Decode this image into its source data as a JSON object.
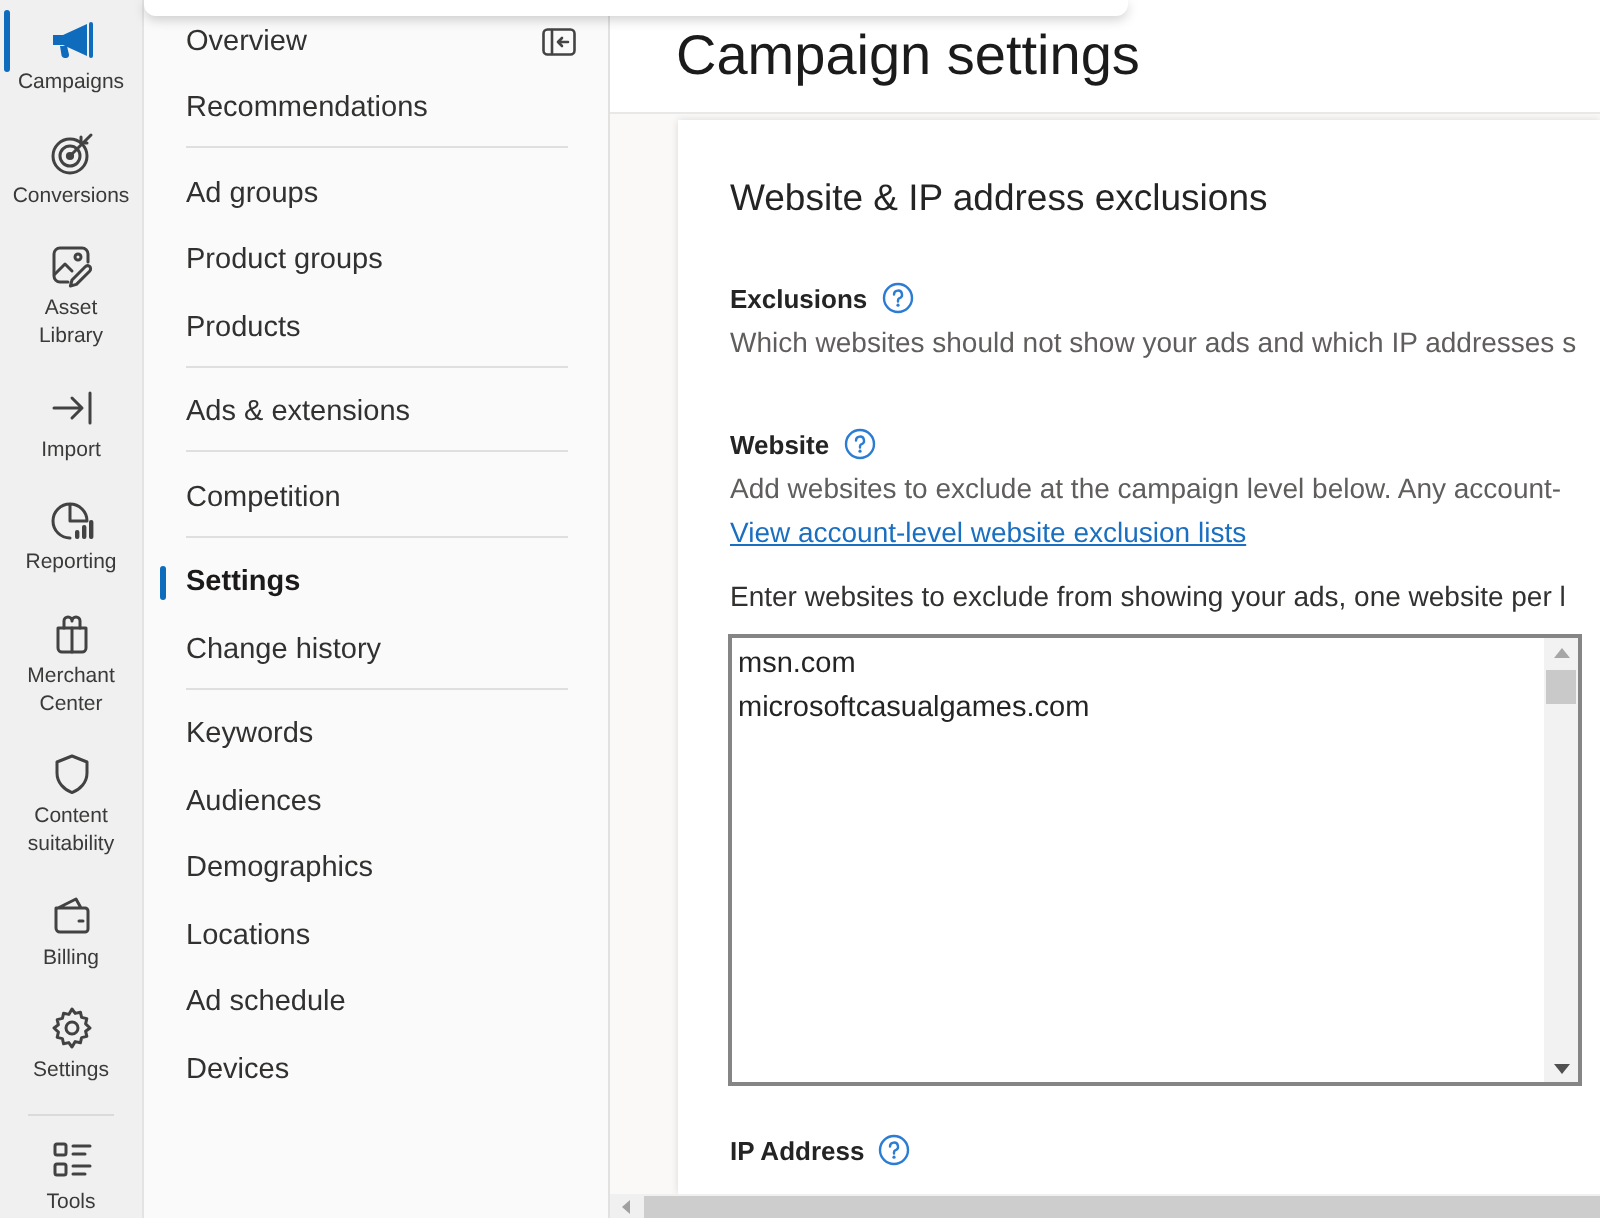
{
  "rail": {
    "groups": [
      {
        "items": [
          {
            "label": "Campaigns",
            "selected": true
          },
          {
            "label": "Conversions",
            "selected": false
          },
          {
            "label": "Asset Library",
            "selected": false
          },
          {
            "label": "Import",
            "selected": false
          },
          {
            "label": "Reporting",
            "selected": false
          },
          {
            "label": "Merchant Center",
            "selected": false
          },
          {
            "label": "Content suitability",
            "selected": false
          },
          {
            "label": "Billing",
            "selected": false
          },
          {
            "label": "Settings",
            "selected": false
          }
        ]
      },
      {
        "items": [
          {
            "label": "Tools",
            "selected": false
          }
        ]
      }
    ]
  },
  "nav": {
    "sections": [
      {
        "items": [
          {
            "label": "Overview",
            "selected": false
          },
          {
            "label": "Recommendations",
            "selected": false
          }
        ]
      },
      {
        "items": [
          {
            "label": "Ad groups",
            "selected": false
          },
          {
            "label": "Product groups",
            "selected": false
          },
          {
            "label": "Products",
            "selected": false
          }
        ]
      },
      {
        "items": [
          {
            "label": "Ads & extensions",
            "selected": false
          }
        ]
      },
      {
        "items": [
          {
            "label": "Competition",
            "selected": false
          }
        ]
      },
      {
        "items": [
          {
            "label": "Settings",
            "selected": true
          },
          {
            "label": "Change history",
            "selected": false
          }
        ]
      },
      {
        "items": [
          {
            "label": "Keywords",
            "selected": false
          },
          {
            "label": "Audiences",
            "selected": false
          },
          {
            "label": "Demographics",
            "selected": false
          },
          {
            "label": "Locations",
            "selected": false
          },
          {
            "label": "Ad schedule",
            "selected": false
          },
          {
            "label": "Devices",
            "selected": false
          }
        ]
      }
    ]
  },
  "page": {
    "title": "Campaign settings"
  },
  "card": {
    "title": "Website & IP address exclusions",
    "sections": [
      {
        "label": "Exclusions",
        "description": "Which websites should not show your ads and which IP addresses s"
      },
      {
        "label": "Website",
        "description": "Add websites to exclude at the campaign level below. Any account-",
        "link": "View account-level website exclusion lists",
        "instruction": "Enter websites to exclude from showing your ads, one website per l",
        "entries": [
          "msn.com",
          "microsoftcasualgames.com"
        ]
      },
      {
        "label": "IP Address"
      }
    ]
  }
}
